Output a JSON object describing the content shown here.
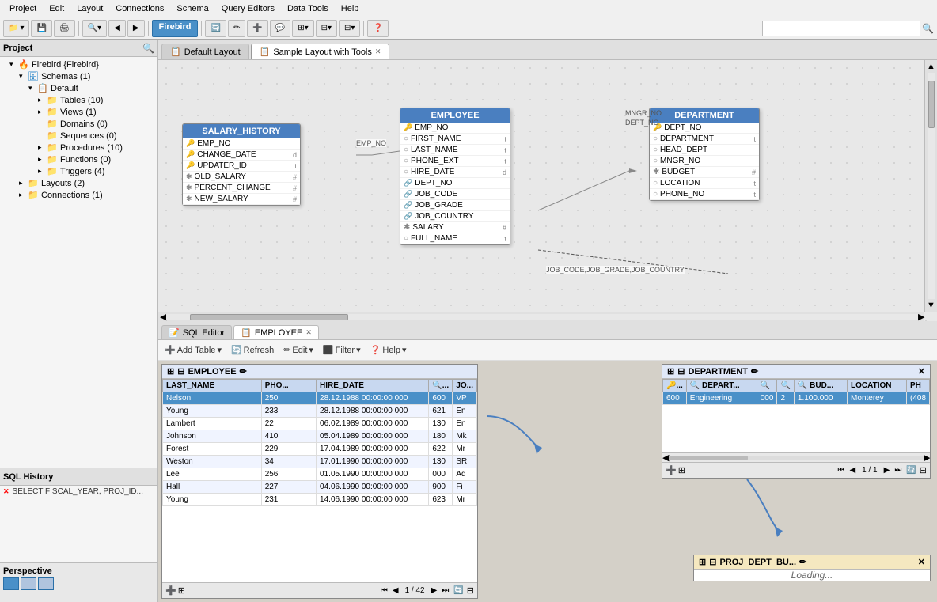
{
  "menubar": {
    "items": [
      "Project",
      "Edit",
      "Layout",
      "Connections",
      "Schema",
      "Query Editors",
      "Data Tools",
      "Help"
    ]
  },
  "toolbar": {
    "firebird_label": "Firebird",
    "search_placeholder": ""
  },
  "left_panel": {
    "title": "Project",
    "tree": [
      {
        "id": "firebird",
        "label": "Firebird {Firebird}",
        "indent": 1,
        "expanded": true,
        "icon": "db"
      },
      {
        "id": "schemas",
        "label": "Schemas (1)",
        "indent": 2,
        "expanded": true,
        "icon": "schema"
      },
      {
        "id": "default",
        "label": "Default",
        "indent": 3,
        "expanded": true,
        "icon": "schema"
      },
      {
        "id": "tables",
        "label": "Tables (10)",
        "indent": 4,
        "expanded": false,
        "icon": "folder"
      },
      {
        "id": "views",
        "label": "Views (1)",
        "indent": 4,
        "expanded": false,
        "icon": "folder"
      },
      {
        "id": "domains",
        "label": "Domains (0)",
        "indent": 4,
        "expanded": false,
        "icon": "folder"
      },
      {
        "id": "sequences",
        "label": "Sequences (0)",
        "indent": 4,
        "expanded": false,
        "icon": "folder"
      },
      {
        "id": "procedures",
        "label": "Procedures (10)",
        "indent": 4,
        "expanded": false,
        "icon": "folder"
      },
      {
        "id": "functions",
        "label": "Functions (0)",
        "indent": 4,
        "expanded": false,
        "icon": "folder"
      },
      {
        "id": "triggers",
        "label": "Triggers (4)",
        "indent": 4,
        "expanded": false,
        "icon": "folder"
      },
      {
        "id": "layouts",
        "label": "Layouts (2)",
        "indent": 2,
        "expanded": false,
        "icon": "folder"
      },
      {
        "id": "connections",
        "label": "Connections (1)",
        "indent": 2,
        "expanded": false,
        "icon": "folder"
      }
    ],
    "sql_history": {
      "title": "SQL History",
      "items": [
        "SELECT FISCAL_YEAR, PROJ_ID..."
      ]
    },
    "perspective": {
      "label": "Perspective"
    }
  },
  "tabs": [
    {
      "id": "default-layout",
      "label": "Default Layout",
      "closable": false,
      "active": false
    },
    {
      "id": "sample-layout",
      "label": "Sample Layout with Tools",
      "closable": true,
      "active": true
    }
  ],
  "diagram": {
    "tables": {
      "salary_history": {
        "title": "SALARY_HISTORY",
        "columns": [
          {
            "name": "EMP_NO",
            "icon": "pk",
            "type": ""
          },
          {
            "name": "CHANGE_DATE",
            "icon": "pk",
            "type": "d"
          },
          {
            "name": "UPDATER_ID",
            "icon": "pk",
            "type": "t"
          },
          {
            "name": "OLD_SALARY",
            "icon": "asterisk",
            "type": "#"
          },
          {
            "name": "PERCENT_CHANGE",
            "icon": "asterisk",
            "type": "#"
          },
          {
            "name": "NEW_SALARY",
            "icon": "asterisk",
            "type": "#"
          }
        ]
      },
      "employee": {
        "title": "EMPLOYEE",
        "columns": [
          {
            "name": "EMP_NO",
            "icon": "pk",
            "type": ""
          },
          {
            "name": "FIRST_NAME",
            "icon": "circle",
            "type": "t"
          },
          {
            "name": "LAST_NAME",
            "icon": "circle",
            "type": "t"
          },
          {
            "name": "PHONE_EXT",
            "icon": "circle",
            "type": "t"
          },
          {
            "name": "HIRE_DATE",
            "icon": "circle",
            "type": "d"
          },
          {
            "name": "DEPT_NO",
            "icon": "fk",
            "type": ""
          },
          {
            "name": "JOB_CODE",
            "icon": "fk",
            "type": ""
          },
          {
            "name": "JOB_GRADE",
            "icon": "fk",
            "type": ""
          },
          {
            "name": "JOB_COUNTRY",
            "icon": "fk",
            "type": ""
          },
          {
            "name": "SALARY",
            "icon": "asterisk",
            "type": "#"
          },
          {
            "name": "FULL_NAME",
            "icon": "circle",
            "type": "t"
          }
        ]
      },
      "department": {
        "title": "DEPARTMENT",
        "columns": [
          {
            "name": "DEPT_NO",
            "icon": "pk",
            "type": ""
          },
          {
            "name": "DEPARTMENT",
            "icon": "circle",
            "type": "t"
          },
          {
            "name": "HEAD_DEPT",
            "icon": "fk",
            "type": ""
          },
          {
            "name": "MNGR_NO",
            "icon": "fk",
            "type": ""
          },
          {
            "name": "BUDGET",
            "icon": "asterisk",
            "type": "#"
          },
          {
            "name": "LOCATION",
            "icon": "circle",
            "type": "t"
          },
          {
            "name": "PHONE_NO",
            "icon": "circle",
            "type": "t"
          }
        ]
      }
    }
  },
  "bottom_tabs": [
    {
      "id": "sql-editor",
      "label": "SQL Editor",
      "icon": "sql"
    },
    {
      "id": "employee",
      "label": "EMPLOYEE",
      "closable": true,
      "active": true
    }
  ],
  "data_toolbar": {
    "add_table": "Add Table",
    "refresh": "Refresh",
    "edit": "Edit",
    "filter": "Filter",
    "help": "Help"
  },
  "employee_table": {
    "title": "EMPLOYEE",
    "columns": [
      "LAST_NAME",
      "PHO...",
      "HIRE_DATE",
      "🔍...",
      "JO..."
    ],
    "rows": [
      {
        "last_name": "Nelson",
        "phone": "250",
        "hire_date": "28.12.1988 00:00:00 000",
        "col4": "600",
        "col5": "VP",
        "selected": true
      },
      {
        "last_name": "Young",
        "phone": "233",
        "hire_date": "28.12.1988 00:00:00 000",
        "col4": "621",
        "col5": "En"
      },
      {
        "last_name": "Lambert",
        "phone": "22",
        "hire_date": "06.02.1989 00:00:00 000",
        "col4": "130",
        "col5": "En"
      },
      {
        "last_name": "Johnson",
        "phone": "410",
        "hire_date": "05.04.1989 00:00:00 000",
        "col4": "180",
        "col5": "Mk"
      },
      {
        "last_name": "Forest",
        "phone": "229",
        "hire_date": "17.04.1989 00:00:00 000",
        "col4": "622",
        "col5": "Mr"
      },
      {
        "last_name": "Weston",
        "phone": "34",
        "hire_date": "17.01.1990 00:00:00 000",
        "col4": "130",
        "col5": "SR"
      },
      {
        "last_name": "Lee",
        "phone": "256",
        "hire_date": "01.05.1990 00:00:00 000",
        "col4": "000",
        "col5": "Ad"
      },
      {
        "last_name": "Hall",
        "phone": "227",
        "hire_date": "04.06.1990 00:00:00 000",
        "col4": "900",
        "col5": "Fi"
      },
      {
        "last_name": "Young",
        "phone": "231",
        "hire_date": "14.06.1990 00:00:00 000",
        "col4": "623",
        "col5": "Mr"
      }
    ],
    "nav": "1 / 42"
  },
  "department_table": {
    "title": "DEPARTMENT",
    "columns": [
      "🔑...",
      "🔍 DEPART...",
      "🔍",
      "🔍",
      "🔍 BUD...",
      "LOCATION",
      "PH"
    ],
    "rows": [
      {
        "col1": "600",
        "col2": "Engineering",
        "col3": "000",
        "col4": "2",
        "col5": "1.100.000",
        "col6": "Monterey",
        "col7": "(408"
      }
    ],
    "nav": "1 / 1"
  },
  "proj_table": {
    "title": "PROJ_DEPT_BU...",
    "loading": "Loading..."
  },
  "colors": {
    "accent": "#4a90c8",
    "selected_row": "#4a90c8",
    "table_header_bg": "#4a7fc0",
    "tab_active_bg": "#ffffff",
    "firebird_btn": "#4a90c8",
    "proj_header": "#f5e8c0"
  }
}
